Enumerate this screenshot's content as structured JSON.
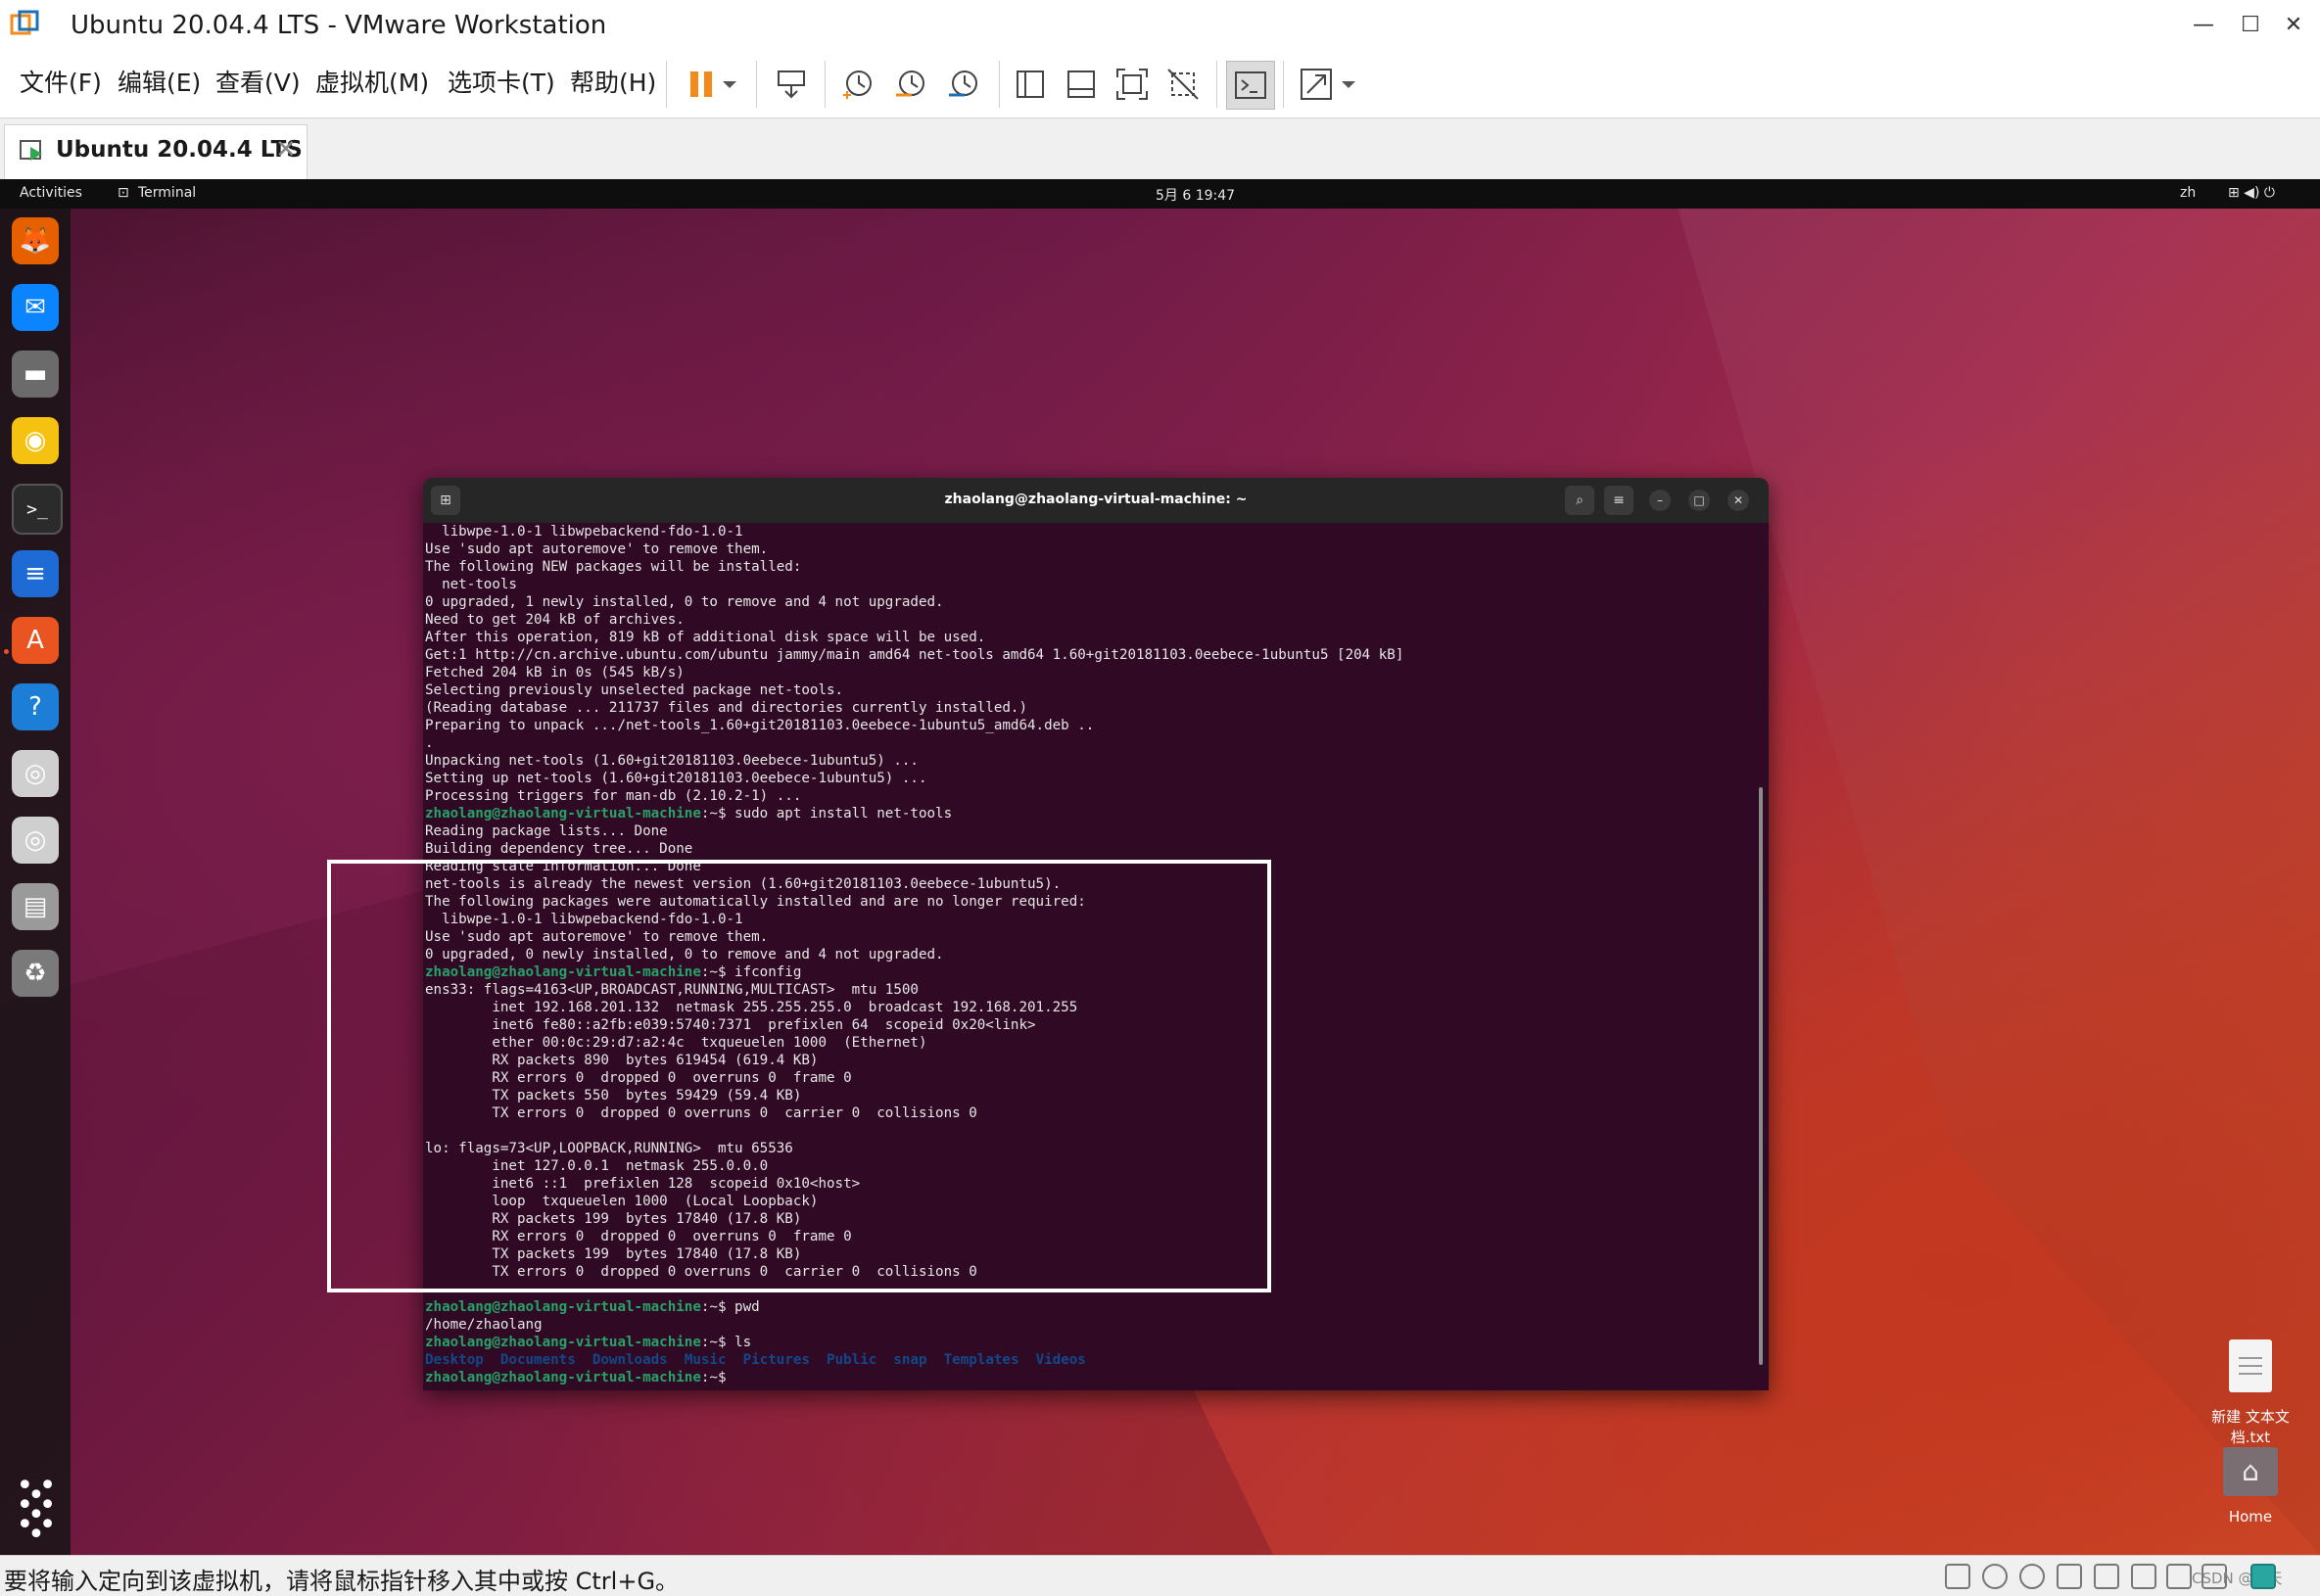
{
  "window": {
    "title": "Ubuntu 20.04.4 LTS - VMware Workstation",
    "minimize": "—",
    "maximize": "☐",
    "close": "✕"
  },
  "menu": [
    {
      "label": "文件(F)"
    },
    {
      "label": "编辑(E)"
    },
    {
      "label": "查看(V)"
    },
    {
      "label": "虚拟机(M)"
    },
    {
      "label": "选项卡(T)"
    },
    {
      "label": "帮助(H)"
    }
  ],
  "tab": {
    "label": "Ubuntu 20.04.4 LTS",
    "close": "✕"
  },
  "guest": {
    "topbar": {
      "activities": "Activities",
      "app": "Terminal",
      "clock": "5月 6  19:47",
      "lang": "zh",
      "tray_glyphs": "⊞  ◀)  ⏻"
    },
    "dock_apps": [
      {
        "name": "firefox-icon",
        "glyph": "🦊",
        "color": "#e66000"
      },
      {
        "name": "thunderbird-icon",
        "glyph": "✉",
        "color": "#0a84ff"
      },
      {
        "name": "files-icon",
        "glyph": "▬",
        "color": "#6b6b6b"
      },
      {
        "name": "rhythmbox-icon",
        "glyph": "◉",
        "color": "#f5c211"
      },
      {
        "name": "terminal-icon",
        "glyph": ">_",
        "color": "#2b2b2b"
      },
      {
        "name": "writer-icon",
        "glyph": "≡",
        "color": "#1e6bd6"
      },
      {
        "name": "software-icon",
        "glyph": "A",
        "color": "#e95420"
      },
      {
        "name": "help-icon",
        "glyph": "?",
        "color": "#1c7ed6"
      },
      {
        "name": "disc-icon",
        "glyph": "◎",
        "color": "#cfcfcf"
      },
      {
        "name": "disc-icon-2",
        "glyph": "◎",
        "color": "#cfcfcf"
      },
      {
        "name": "floppy-icon",
        "glyph": "▤",
        "color": "#9a9a9a"
      },
      {
        "name": "trash-icon",
        "glyph": "♻",
        "color": "#7a7a7a"
      }
    ],
    "apps_grid": "⋮⋮⋮",
    "desktop_icons": [
      {
        "label": "新建 文本文档.txt"
      },
      {
        "label": "Home"
      }
    ]
  },
  "terminal": {
    "title": "zhaolang@zhaolang-virtual-machine: ~",
    "lines": [
      {
        "t": "  libwpe-1.0-1 libwpebackend-fdo-1.0-1"
      },
      {
        "t": "Use 'sudo apt autoremove' to remove them."
      },
      {
        "t": "The following NEW packages will be installed:"
      },
      {
        "t": "  net-tools"
      },
      {
        "t": "0 upgraded, 1 newly installed, 0 to remove and 4 not upgraded."
      },
      {
        "t": "Need to get 204 kB of archives."
      },
      {
        "t": "After this operation, 819 kB of additional disk space will be used."
      },
      {
        "t": "Get:1 http://cn.archive.ubuntu.com/ubuntu jammy/main amd64 net-tools amd64 1.60+git20181103.0eebece-1ubuntu5 [204 kB]"
      },
      {
        "t": "Fetched 204 kB in 0s (545 kB/s)"
      },
      {
        "t": "Selecting previously unselected package net-tools."
      },
      {
        "t": "(Reading database ... 211737 files and directories currently installed.)"
      },
      {
        "t": "Preparing to unpack .../net-tools_1.60+git20181103.0eebece-1ubuntu5_amd64.deb .."
      },
      {
        "t": "."
      },
      {
        "t": "Unpacking net-tools (1.60+git20181103.0eebece-1ubuntu5) ..."
      },
      {
        "t": "Setting up net-tools (1.60+git20181103.0eebece-1ubuntu5) ..."
      },
      {
        "t": "Processing triggers for man-db (2.10.2-1) ..."
      },
      {
        "p": "zhaolang@zhaolang-virtual-machine",
        "t": ":~$ sudo apt install net-tools"
      },
      {
        "t": "Reading package lists... Done"
      },
      {
        "t": "Building dependency tree... Done"
      },
      {
        "t": "Reading state information... Done"
      },
      {
        "t": "net-tools is already the newest version (1.60+git20181103.0eebece-1ubuntu5)."
      },
      {
        "t": "The following packages were automatically installed and are no longer required:"
      },
      {
        "t": "  libwpe-1.0-1 libwpebackend-fdo-1.0-1"
      },
      {
        "t": "Use 'sudo apt autoremove' to remove them."
      },
      {
        "t": "0 upgraded, 0 newly installed, 0 to remove and 4 not upgraded."
      },
      {
        "p": "zhaolang@zhaolang-virtual-machine",
        "t": ":~$ ifconfig"
      },
      {
        "t": "ens33: flags=4163<UP,BROADCAST,RUNNING,MULTICAST>  mtu 1500"
      },
      {
        "t": "        inet 192.168.201.132  netmask 255.255.255.0  broadcast 192.168.201.255"
      },
      {
        "t": "        inet6 fe80::a2fb:e039:5740:7371  prefixlen 64  scopeid 0x20<link>"
      },
      {
        "t": "        ether 00:0c:29:d7:a2:4c  txqueuelen 1000  (Ethernet)"
      },
      {
        "t": "        RX packets 890  bytes 619454 (619.4 KB)"
      },
      {
        "t": "        RX errors 0  dropped 0  overruns 0  frame 0"
      },
      {
        "t": "        TX packets 550  bytes 59429 (59.4 KB)"
      },
      {
        "t": "        TX errors 0  dropped 0 overruns 0  carrier 0  collisions 0"
      },
      {
        "t": ""
      },
      {
        "t": "lo: flags=73<UP,LOOPBACK,RUNNING>  mtu 65536"
      },
      {
        "t": "        inet 127.0.0.1  netmask 255.0.0.0"
      },
      {
        "t": "        inet6 ::1  prefixlen 128  scopeid 0x10<host>"
      },
      {
        "t": "        loop  txqueuelen 1000  (Local Loopback)"
      },
      {
        "t": "        RX packets 199  bytes 17840 (17.8 KB)"
      },
      {
        "t": "        RX errors 0  dropped 0  overruns 0  frame 0"
      },
      {
        "t": "        TX packets 199  bytes 17840 (17.8 KB)"
      },
      {
        "t": "        TX errors 0  dropped 0 overruns 0  carrier 0  collisions 0"
      },
      {
        "t": ""
      },
      {
        "p": "zhaolang@zhaolang-virtual-machine",
        "t": ":~$ pwd"
      },
      {
        "t": "/home/zhaolang"
      },
      {
        "p": "zhaolang@zhaolang-virtual-machine",
        "t": ":~$ ls"
      },
      {
        "dirs": [
          "Desktop",
          "Documents",
          "Downloads",
          "Music",
          "Pictures",
          "Public",
          "snap",
          "Templates",
          "Videos"
        ]
      },
      {
        "p": "zhaolang@zhaolang-virtual-machine",
        "t": ":~$ "
      }
    ]
  },
  "statusbar": {
    "message": "要将输入定向到该虚拟机，请将鼠标指针移入其中或按 Ctrl+G。",
    "watermark": "CSDN @晨天"
  },
  "colors": {
    "terminal_bg": "#300a24",
    "prompt": "#26a269",
    "dir": "#12488b",
    "pause_orange": "#f28b1a"
  }
}
